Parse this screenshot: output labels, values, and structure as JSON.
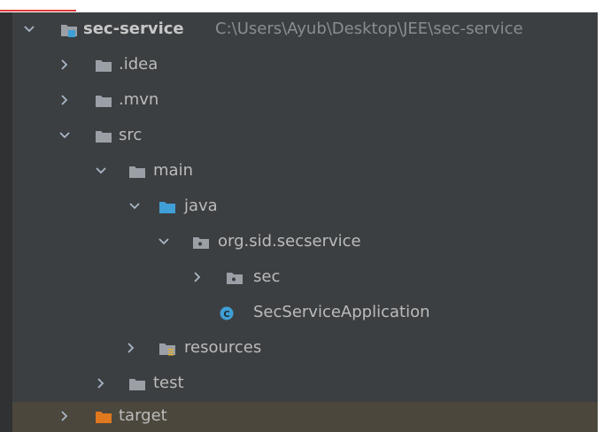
{
  "tree": {
    "rows": [
      {
        "label": "sec-service",
        "path": "C:\\Users\\Ayub\\Desktop\\JEE\\sec-service",
        "icon": "module-folder-icon",
        "expanded": true
      },
      {
        "label": ".idea",
        "icon": "folder-icon",
        "expanded": false
      },
      {
        "label": ".mvn",
        "icon": "folder-icon",
        "expanded": false
      },
      {
        "label": "src",
        "icon": "folder-icon",
        "expanded": true
      },
      {
        "label": "main",
        "icon": "folder-icon",
        "expanded": true
      },
      {
        "label": "java",
        "icon": "source-root-folder-icon",
        "expanded": true
      },
      {
        "label": "org.sid.secservice",
        "icon": "package-icon",
        "expanded": true
      },
      {
        "label": "sec",
        "icon": "package-icon",
        "expanded": false
      },
      {
        "label": "SecServiceApplication",
        "icon": "class-icon"
      },
      {
        "label": "resources",
        "icon": "resources-folder-icon",
        "expanded": false
      },
      {
        "label": "test",
        "icon": "folder-icon",
        "expanded": false
      },
      {
        "label": "target",
        "icon": "excluded-folder-icon",
        "expanded": false,
        "selected": true
      }
    ]
  },
  "colors": {
    "background": "#3c3f41",
    "selection": "#4b473d",
    "folder": "#9aa0a6",
    "source_root": "#3f9fd6",
    "excluded": "#e0781e",
    "class_icon": "#3f9fd6"
  }
}
